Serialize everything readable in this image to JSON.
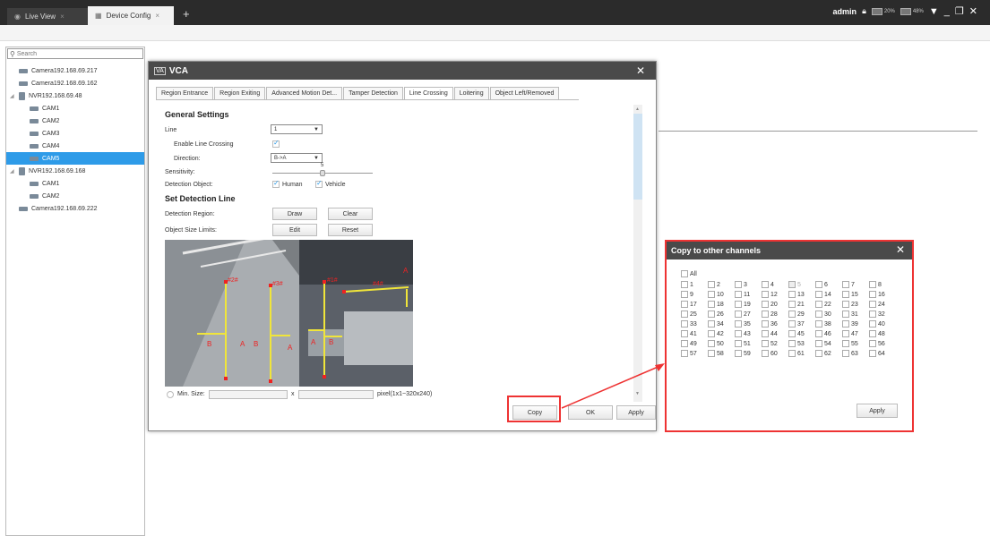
{
  "tabs": [
    {
      "label": "Live View",
      "icon": "eye-icon"
    },
    {
      "label": "Device Config",
      "icon": "device-config-icon"
    }
  ],
  "user": {
    "name": "admin",
    "cpu": "20%",
    "mem": "48%"
  },
  "search": {
    "placeholder": "Search"
  },
  "tree": [
    {
      "label": "Camera192.168.69.217",
      "type": "camera",
      "indent": 0
    },
    {
      "label": "Camera192.168.69.162",
      "type": "camera",
      "indent": 0
    },
    {
      "label": "NVR192.168.69.48",
      "type": "nvr",
      "indent": 0
    },
    {
      "label": "CAM1",
      "type": "camera",
      "indent": 1
    },
    {
      "label": "CAM2",
      "type": "camera",
      "indent": 1
    },
    {
      "label": "CAM3",
      "type": "camera",
      "indent": 1
    },
    {
      "label": "CAM4",
      "type": "camera",
      "indent": 1
    },
    {
      "label": "CAM5",
      "type": "camera",
      "indent": 1,
      "selected": true
    },
    {
      "label": "NVR192.168.69.168",
      "type": "nvr",
      "indent": 0
    },
    {
      "label": "CAM1",
      "type": "camera",
      "indent": 1
    },
    {
      "label": "CAM2",
      "type": "camera",
      "indent": 1
    },
    {
      "label": "Camera192.168.69.222",
      "type": "camera",
      "indent": 0
    }
  ],
  "vca": {
    "logo": "VA",
    "title": "VCA",
    "tabs": [
      "Region Entrance",
      "Region Exiting",
      "Advanced Motion Det...",
      "Tamper Detection",
      "Line Crossing",
      "Loitering",
      "Object Left/Removed"
    ],
    "active_tab": 4,
    "general_settings": "General Settings",
    "line_label": "Line",
    "line_value": "1",
    "enable_label": "Enable Line Crossing",
    "direction_label": "Direction:",
    "direction_value": "B->A",
    "sensitivity_label": "Sensitivity:",
    "sensitivity_value": "5",
    "sensitivity_fraction": 0.5,
    "detection_object_label": "Detection Object:",
    "human_label": "Human",
    "vehicle_label": "Vehicle",
    "set_detection_line": "Set Detection Line",
    "detection_region_label": "Detection Region:",
    "draw_btn": "Draw",
    "clear_btn": "Clear",
    "object_size_label": "Object Size Limits:",
    "edit_btn": "Edit",
    "reset_btn": "Reset",
    "min_size_label": "Min. Size:",
    "x_label": "x",
    "pixel_range": "pixel(1x1~320x240)",
    "copy_btn": "Copy",
    "ok_btn": "OK",
    "apply_btn": "Apply",
    "line_labels": [
      "#2#",
      "#3#",
      "#1#",
      "#4#"
    ],
    "side_labels": [
      "A",
      "B",
      "A",
      "B",
      "A",
      "A",
      "B"
    ]
  },
  "copy": {
    "title": "Copy to other channels",
    "all_label": "All",
    "channels": [
      "1",
      "2",
      "3",
      "4",
      "5",
      "6",
      "7",
      "8",
      "9",
      "10",
      "11",
      "12",
      "13",
      "14",
      "15",
      "16",
      "17",
      "18",
      "19",
      "20",
      "21",
      "22",
      "23",
      "24",
      "25",
      "26",
      "27",
      "28",
      "29",
      "30",
      "31",
      "32",
      "33",
      "34",
      "35",
      "36",
      "37",
      "38",
      "39",
      "40",
      "41",
      "42",
      "43",
      "44",
      "45",
      "46",
      "47",
      "48",
      "49",
      "50",
      "51",
      "52",
      "53",
      "54",
      "55",
      "56",
      "57",
      "58",
      "59",
      "60",
      "61",
      "62",
      "63",
      "64"
    ],
    "disabled_channel": "5",
    "apply_btn": "Apply"
  }
}
